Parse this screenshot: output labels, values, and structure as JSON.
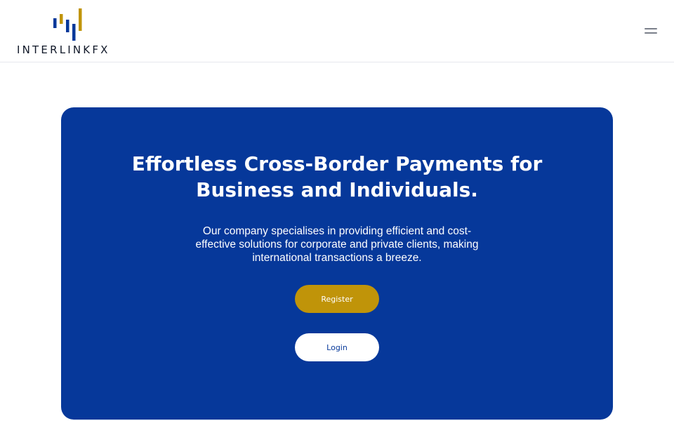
{
  "header": {
    "logo_text": "INTERLINKFX",
    "menu_icon": "hamburger-menu-icon"
  },
  "hero": {
    "title_line1": "Effortless Cross-Border Payments for",
    "title_line2": "Business and Individuals.",
    "description": "Our company specialises in providing efficient and cost-effective solutions for corporate and private clients, making international transactions a breeze.",
    "register_label": "Register",
    "login_label": "Login"
  },
  "colors": {
    "brand_blue": "#06389a",
    "brand_gold": "#c09409",
    "text_dark": "#101828"
  }
}
